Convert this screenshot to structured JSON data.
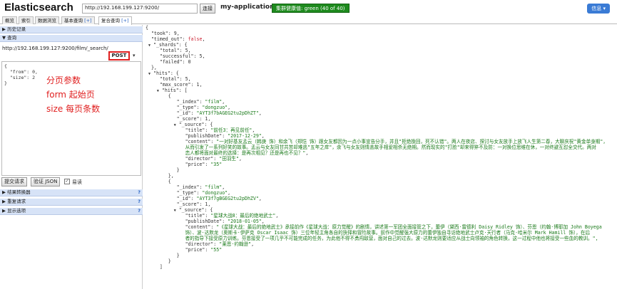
{
  "header": {
    "logo": "Elasticsearch",
    "url": "http://192.168.199.127:9200/",
    "connect_label": "连接",
    "cluster_name": "my-application",
    "health": "集群健康值: green (40 of 40)",
    "info_label": "信息 ▾"
  },
  "tabs": [
    {
      "label": "概览",
      "plus": ""
    },
    {
      "label": "索引",
      "plus": ""
    },
    {
      "label": "数据浏览",
      "plus": ""
    },
    {
      "label": "基本查询",
      "plus": "[+]"
    },
    {
      "label": "复合查询",
      "plus": "[+]"
    }
  ],
  "left": {
    "history_label": "▶ 历史记录",
    "query_label": "▼ 查询",
    "endpoint": "http://192.168.199.127:9200/film/_search/",
    "method": "POST",
    "caret": "▾",
    "body_text": "{\n  \"from\": 0,\n  \"size\": 2\n}",
    "annotations": [
      "分页参数",
      "form 起始页",
      "size 每页条数"
    ],
    "submit_label": "提交请求",
    "validate_label": "验证 JSON",
    "check_mark": "✓",
    "pretty_label": "易读",
    "result_transformer": "▶ 结果转换器",
    "repeat_request": "▶ 重复请求",
    "display_options": "▶ 显示选项",
    "help_mark": "?"
  },
  "response": {
    "took": "9",
    "timed_out": "false",
    "shards_total": "5",
    "shards_successful": "5",
    "shards_failed": "0",
    "hits_total": "5",
    "max_score": "1",
    "hits": [
      {
        "index": "\"film\"",
        "type": "\"dongzuo\"",
        "id": "\"AYT3f7bAGEG2tu2pDhZT\"",
        "score": "1",
        "title": "\"前任3：再见前任\"",
        "publishDate": "\"2017-12-29\"",
        "content_lines": [
          "\"一对好基友孟云（韩庚 饰）和余飞（郑恺 饰）跟女友都因为一点小事宣告分手，并且\"拒绝挽回，死不认错\"。两人在夜店、探讨与女友放手上放飞人生第二春，大聊庆祝\"黄金单身期\"，",
          "从而引发了一系列好笑的故事。孟云与女友同甘共苦却难逃\"五年之痒\"，余飞与女友则情盖故手相爱相杀无绝期。然而现实的\"打脸\"却来得猝不及防：一对换位思维在休，一对终避互怼全交代。两对",
          "恋人都将面对最终的选择：是再次相见？还是再也不见？\""
        ],
        "director": "\"田羽生\"",
        "price": "\"35\""
      },
      {
        "index": "\"film\"",
        "type": "\"dongzuo\"",
        "id": "\"AYT3f7gBGEG2tu2pDhZV\"",
        "score": "1",
        "title": "\"星球大战8：最后的绝地武士\"",
        "publishDate": "\"2018-01-05\"",
        "content_lines": [
          "\"《星球大战：最后的绝地武士》承接前作《星球大战：原力觉醒》的剧情，讲述第一军团全面接管之下，蕾伊（黛西·雷德利 Daisy Ridley 饰）、芬恩（约翰·博耶加 John Boyega",
          "饰）、波·达默龙（奥斯卡·伊萨克 Oscar Isaac 饰）三位年轻主角各自的抉择和冒险故事。前作中觉醒强大原力的蕾伊独自寻访绝地武士卢克·天行者（马克·哈米尔 Mark Hamill 饰），在后",
          "者的指导下接受原力训练。芬恩接受了一项几乎不可能完成的任务，为此他不得不勇闯敌营，面对自己的过去。波·达默龙则要适应从战士向领袖的角色转换，这一过程中他也将接受一些血的教训。\","
        ],
        "director": "\"莱恩·约翰逊\"",
        "price": "\"55\""
      }
    ]
  }
}
